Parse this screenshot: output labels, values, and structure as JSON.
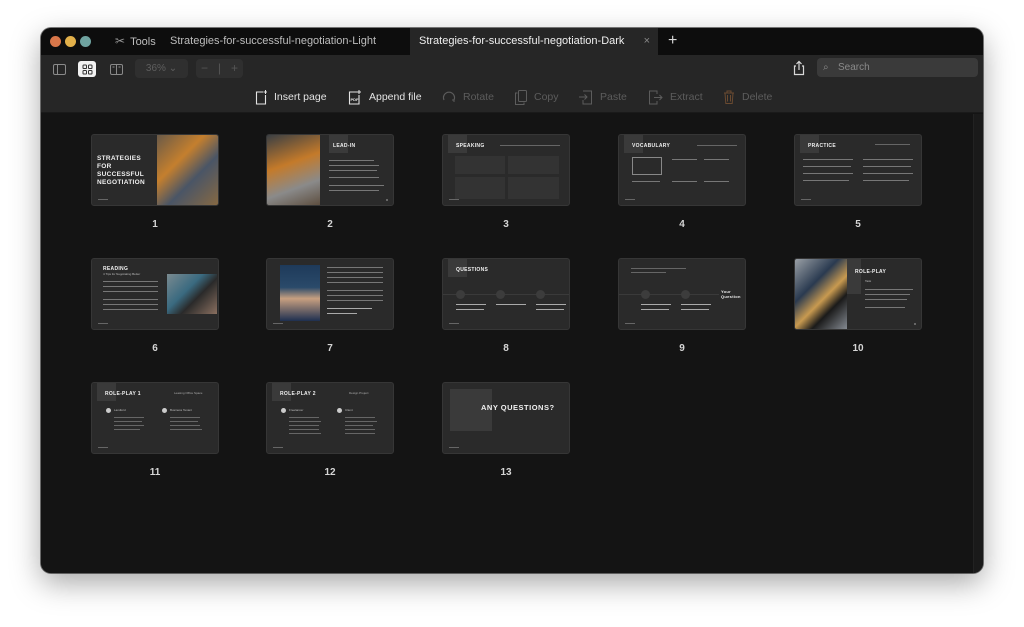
{
  "window": {
    "traffic_lights": [
      "close",
      "minimize",
      "maximize"
    ],
    "colors": {
      "close": "#d9774a",
      "minimize": "#e2b04a",
      "maximize": "#6fa3a0"
    }
  },
  "tabs": [
    {
      "label": "Tools",
      "icon": "tools-icon",
      "active": false
    },
    {
      "label": "Strategies-for-successful-negotiation-Light",
      "active": false
    },
    {
      "label": "Strategies-for-successful-negotiation-Dark",
      "active": true,
      "close_icon": "×"
    }
  ],
  "new_tab_label": "+",
  "toolbar": {
    "view_modes": [
      "sidebar-view",
      "grid-view",
      "book-view"
    ],
    "active_view": "grid-view",
    "zoom_level": "36%",
    "zoom_minus": "−",
    "zoom_plus": "+",
    "search_placeholder": "Search"
  },
  "actions": [
    {
      "label": "Insert page",
      "icon": "insert-page-icon",
      "enabled": true
    },
    {
      "label": "Append file",
      "icon": "append-pdf-icon",
      "enabled": true
    },
    {
      "label": "Rotate",
      "icon": "rotate-icon",
      "enabled": false
    },
    {
      "label": "Copy",
      "icon": "copy-icon",
      "enabled": false
    },
    {
      "label": "Paste",
      "icon": "paste-icon",
      "enabled": false
    },
    {
      "label": "Extract",
      "icon": "extract-icon",
      "enabled": false
    },
    {
      "label": "Delete",
      "icon": "trash-icon",
      "enabled": false
    }
  ],
  "pages": [
    {
      "number": "1",
      "title": "STRATEGIES FOR SUCCESSFUL NEGOTIATION"
    },
    {
      "number": "2",
      "title": "LEAD-IN"
    },
    {
      "number": "3",
      "title": "SPEAKING",
      "subtitle": "Review the following situations and describe your actions."
    },
    {
      "number": "4",
      "title": "VOCABULARY",
      "subtitle": "Match the phrases to their categories."
    },
    {
      "number": "5",
      "title": "PRACTICE",
      "subtitle": "Read the dialogues and fill in the gaps with the missing words."
    },
    {
      "number": "6",
      "title": "READING",
      "subtitle": "4 Tips for Negotiating Better"
    },
    {
      "number": "7",
      "title": ""
    },
    {
      "number": "8",
      "title": "QUESTIONS"
    },
    {
      "number": "9",
      "title": "Your Question"
    },
    {
      "number": "10",
      "title": "ROLE-PLAY",
      "subtitle": "Task"
    },
    {
      "number": "11",
      "title": "ROLE-PLAY 1",
      "subtitle": "Leasing Office Space",
      "roles": [
        "Landlord",
        "Business Tenant"
      ]
    },
    {
      "number": "12",
      "title": "ROLE-PLAY 2",
      "subtitle": "Design Project",
      "roles": [
        "Freelancer",
        "Client"
      ]
    },
    {
      "number": "13",
      "title": "ANY QUESTIONS?"
    }
  ]
}
